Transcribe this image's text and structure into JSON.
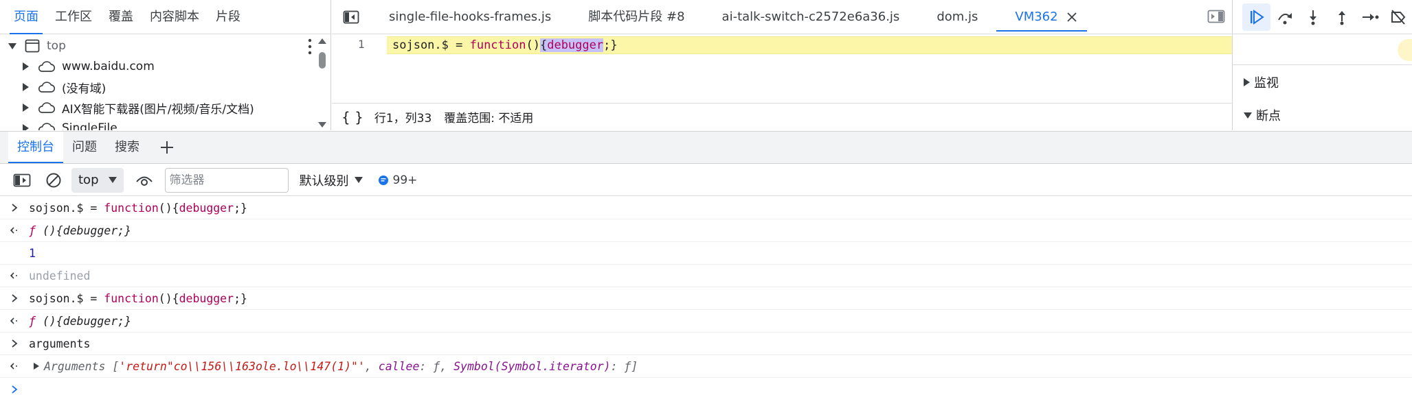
{
  "navigator": {
    "tabs": [
      "页面",
      "工作区",
      "覆盖",
      "内容脚本",
      "片段"
    ],
    "active_tab": 0,
    "tree": [
      {
        "label": "top",
        "expanded": true,
        "icon": "frame-icon",
        "level": 0
      },
      {
        "label": "www.baidu.com",
        "expanded": false,
        "icon": "cloud-icon",
        "level": 1
      },
      {
        "label": "(没有域)",
        "expanded": false,
        "icon": "cloud-icon",
        "level": 1
      },
      {
        "label": "AIX智能下载器(图片/视频/音乐/文档)",
        "expanded": false,
        "icon": "cloud-icon",
        "level": 1
      },
      {
        "label": "SingleFile",
        "expanded": false,
        "icon": "cloud-icon",
        "level": 1
      }
    ]
  },
  "editor": {
    "tabs": [
      {
        "label": "single-file-hooks-frames.js"
      },
      {
        "label": "脚本代码片段 #8"
      },
      {
        "label": "ai-talk-switch-c2572e6a36.js"
      },
      {
        "label": "dom.js"
      },
      {
        "label": "VM362",
        "active": true
      }
    ],
    "line_number": "1",
    "code": {
      "pre": "sojson.$ = ",
      "kw": "function",
      "parens": "()",
      "brace_open": "{",
      "selected": "debugger",
      "rest": ";}"
    },
    "status": {
      "braces": "{ }",
      "position": "行1，列33",
      "coverage": "覆盖范围: 不适用"
    }
  },
  "debugger": {
    "sections": [
      {
        "label": "监视",
        "expanded": false
      },
      {
        "label": "断点",
        "expanded": true
      }
    ]
  },
  "drawer": {
    "tabs": [
      "控制台",
      "问题",
      "搜索"
    ],
    "active_tab": 0
  },
  "console_toolbar": {
    "context": "top",
    "filter_placeholder": "筛选器",
    "filter_value": "",
    "level": "默认级别",
    "message_count": "99+"
  },
  "console": {
    "rows": [
      {
        "kind": "input",
        "pre": "sojson.$ = ",
        "kw": "function",
        "post": "(){",
        "kw2": "debugger",
        "end": ";}"
      },
      {
        "kind": "result",
        "f": "ƒ",
        "text": " (){debugger;}"
      },
      {
        "kind": "log",
        "text": "1"
      },
      {
        "kind": "result-undefined",
        "text": "undefined"
      },
      {
        "kind": "input",
        "pre": "sojson.$ = ",
        "kw": "function",
        "post": "(){",
        "kw2": "debugger",
        "end": ";}"
      },
      {
        "kind": "result",
        "f": "ƒ",
        "text": " (){debugger;}"
      },
      {
        "kind": "input-plain",
        "text": "arguments"
      },
      {
        "kind": "result-args",
        "label": "Arguments [",
        "str": "'return\"co\\\\156\\\\163ole.lo\\\\147(1)\"'",
        "sep1": ", ",
        "callee_key": "callee",
        "callee_val": ": ƒ",
        "sep2": ", ",
        "sym_key": "Symbol(Symbol.iterator)",
        "sym_val": ": ƒ",
        "close": "]"
      }
    ]
  },
  "colors": {
    "accent": "#1a73e8",
    "highlight_line": "#fcf6a8",
    "selection": "#c6c2f7",
    "keyword": "#b0005a"
  }
}
